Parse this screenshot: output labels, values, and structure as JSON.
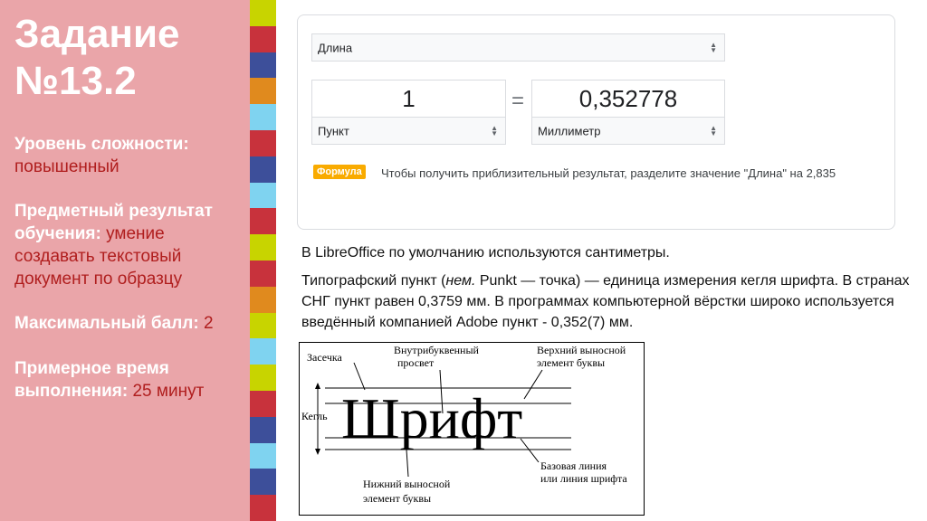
{
  "sidebar": {
    "title_line1": "Задание",
    "title_line2": "№13.2",
    "difficulty_label": "Уровень сложности:",
    "difficulty_value": "повышенный",
    "result_label": "Предметный результат обучения:",
    "result_value": "умение создавать текстовый документ по образцу",
    "max_score_label": "Максимальный балл:",
    "max_score_value": "2",
    "time_label": "Примерное время выполнения:",
    "time_value": "25 минут"
  },
  "stripe_colors": [
    "#c8d400",
    "#c8323c",
    "#3d4f9a",
    "#e08a1e",
    "#7fd3f0",
    "#c8323c",
    "#3d4f9a",
    "#7fd3f0",
    "#c8323c",
    "#c8d400",
    "#c8323c",
    "#e08a1e",
    "#c8d400",
    "#7fd3f0",
    "#c8d400",
    "#c8323c",
    "#3d4f9a",
    "#7fd3f0",
    "#3d4f9a",
    "#c8323c"
  ],
  "converter": {
    "category": "Длина",
    "from_value": "1",
    "from_unit": "Пункт",
    "equals": "=",
    "to_value": "0,352778",
    "to_unit": "Миллиметр",
    "formula_badge": "Формула",
    "formula_text": "Чтобы получить приблизительный результат, разделите значение \"Длина\" на 2,835"
  },
  "text": {
    "p1": "В LibreOffice по умолчанию используются сантиметры.",
    "p2_before": "Типографский пункт (",
    "p2_italic": "нем.",
    "p2_after": " Punkt — точка) — единица измерения кегля шрифта. В странах СНГ пункт равен 0,3759 мм. В программах компьютерной вёрстки широко используется введённый компанией Adobe пункт - 0,352(7) мм."
  },
  "figure": {
    "word": "Шрифт",
    "serif": "Засечка",
    "counter_line1": "Внутрибуквенный",
    "counter_line2": "просвет",
    "ascender_line1": "Верхний выносной",
    "ascender_line2": "элемент буквы",
    "size": "Кегль",
    "baseline_line1": "Базовая линия",
    "baseline_line2": "или линия шрифта",
    "descender_line1": "Нижний выносной",
    "descender_line2": "элемент буквы"
  }
}
